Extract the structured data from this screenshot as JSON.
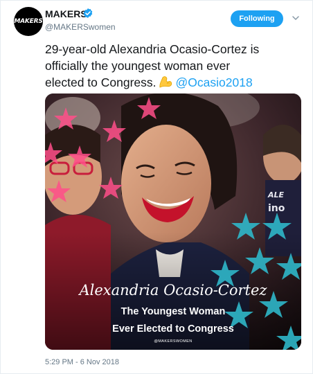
{
  "user": {
    "avatar_text": "MAKERS",
    "display_name": "MAKERS",
    "handle": "@MAKERSwomen",
    "verified": true
  },
  "follow_button": {
    "label": "Following"
  },
  "tweet": {
    "line1": "29-year-old Alexandria Ocasio-Cortez is",
    "line2": "officially the youngest woman ever",
    "line3": "elected to Congress.",
    "emoji": "flexed-biceps-icon",
    "mention": "@Ocasio2018",
    "timestamp": "5:29 PM - 6 Nov 2018"
  },
  "media": {
    "name_overlay": "Alexandria Ocasio-Cortez",
    "subtitle_line1": "The Youngest Woman",
    "subtitle_line2": "Ever Elected to Congress",
    "credit": "@MAKERSWOMEN",
    "background_sign_text": "ALE… ino"
  },
  "colors": {
    "accent": "#1da1f2",
    "pink_star": "#ff4f8a",
    "teal_star": "#2fb7c9",
    "secondary_text": "#657786"
  }
}
